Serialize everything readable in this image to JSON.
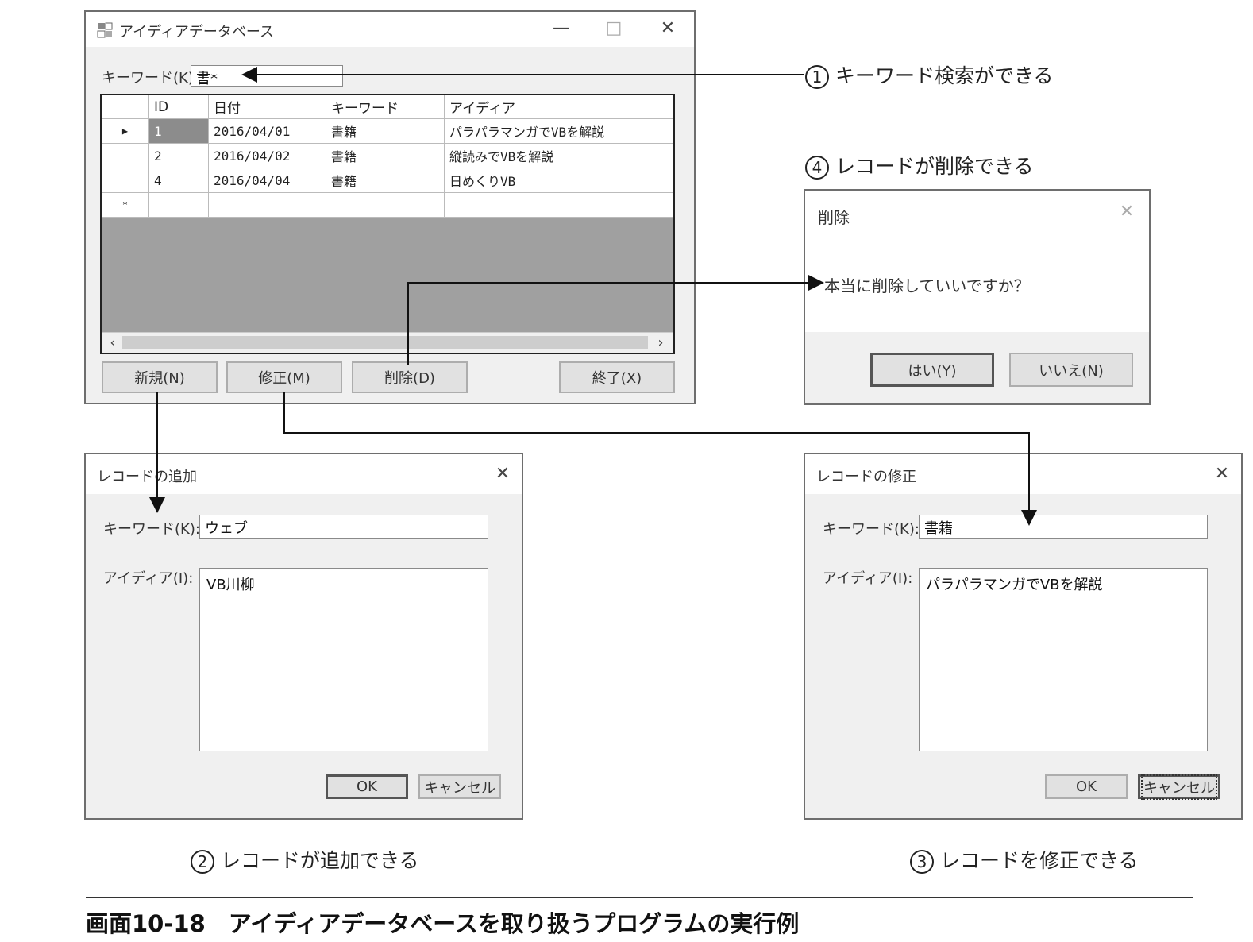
{
  "main_window": {
    "title": "アイディアデータベース",
    "controls": {
      "minimize": "—",
      "maximize": "□",
      "close": "✕"
    },
    "keyword_label": "キーワード(K):",
    "keyword_value": "書*",
    "grid": {
      "columns": [
        "ID",
        "日付",
        "キーワード",
        "アイディア"
      ],
      "rows": [
        {
          "indicator": "▶",
          "id": "1",
          "date": "2016/04/01",
          "keyword": "書籍",
          "idea": "パラパラマンガでVBを解説"
        },
        {
          "indicator": "",
          "id": "2",
          "date": "2016/04/02",
          "keyword": "書籍",
          "idea": "縦読みでVBを解説"
        },
        {
          "indicator": "",
          "id": "4",
          "date": "2016/04/04",
          "keyword": "書籍",
          "idea": "日めくりVB"
        }
      ],
      "new_row_indicator": "*"
    },
    "buttons": {
      "new": "新規(N)",
      "edit": "修正(M)",
      "delete": "削除(D)",
      "exit": "終了(X)"
    }
  },
  "delete_dialog": {
    "title": "削除",
    "message": "本当に削除していいですか？",
    "yes": "はい(Y)",
    "no": "いいえ(N)"
  },
  "add_dialog": {
    "title": "レコードの追加",
    "keyword_label": "キーワード(K):",
    "keyword_value": "ウェブ",
    "idea_label": "アイディア(I):",
    "idea_value": "VB川柳",
    "ok": "OK",
    "cancel": "キャンセル"
  },
  "edit_dialog": {
    "title": "レコードの修正",
    "keyword_label": "キーワード(K):",
    "keyword_value": "書籍",
    "idea_label": "アイディア(I):",
    "idea_value": "パラパラマンガでVBを解説",
    "ok": "OK",
    "cancel": "キャンセル"
  },
  "annotations": {
    "a1": {
      "num": "1",
      "text": "キーワード検索ができる"
    },
    "a2": {
      "num": "2",
      "text": "レコードが追加できる"
    },
    "a3": {
      "num": "3",
      "text": "レコードを修正できる"
    },
    "a4": {
      "num": "4",
      "text": "レコードが削除できる"
    }
  },
  "figure_caption": "画面10-18　アイディアデータベースを取り扱うプログラムの実行例"
}
